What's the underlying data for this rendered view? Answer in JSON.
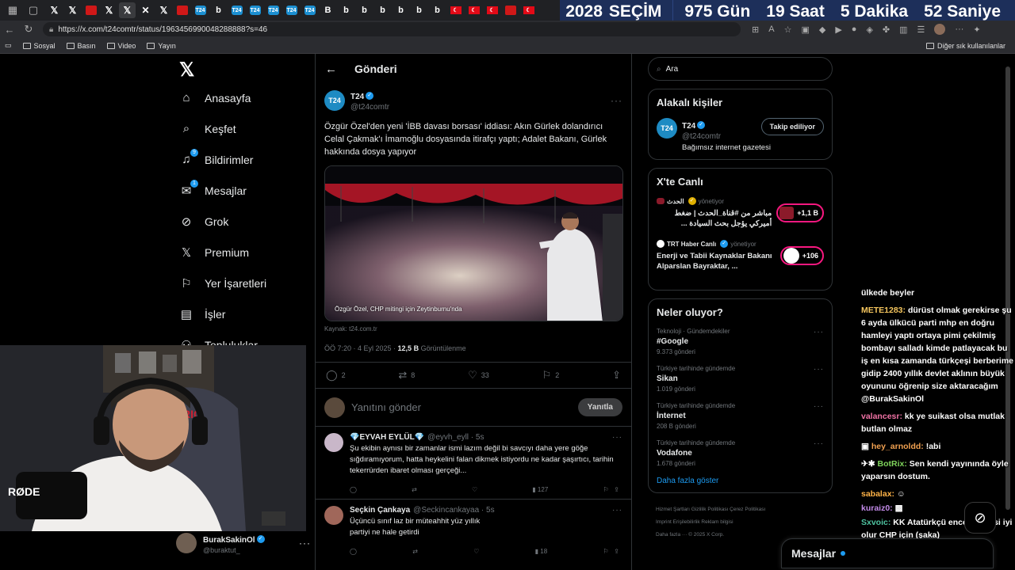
{
  "browser": {
    "url": "https://x.com/t24comtr/status/1963456990048288888?s=46",
    "bookmarks": [
      "Sosyal",
      "Basın",
      "Video",
      "Yayın"
    ],
    "other_bookmarks": "Diğer sık kullanılanlar"
  },
  "countdown": {
    "year": "2028",
    "label": "SEÇİM",
    "days": "975 Gün",
    "hours": "19 Saat",
    "minutes": "5 Dakika",
    "seconds": "52 Saniye"
  },
  "nav": {
    "items": [
      {
        "label": "Anasayfa",
        "icon": "home-icon"
      },
      {
        "label": "Keşfet",
        "icon": "search-icon"
      },
      {
        "label": "Bildirimler",
        "icon": "bell-icon",
        "badge": "9"
      },
      {
        "label": "Mesajlar",
        "icon": "mail-icon",
        "badge": "1"
      },
      {
        "label": "Grok",
        "icon": "grok-icon"
      },
      {
        "label": "Premium",
        "icon": "x-icon"
      },
      {
        "label": "Yer İşaretleri",
        "icon": "bookmark-icon"
      },
      {
        "label": "İşler",
        "icon": "briefcase-icon"
      },
      {
        "label": "Topluluklar",
        "icon": "people-icon"
      }
    ]
  },
  "main": {
    "header": "Gönderi",
    "tweet": {
      "avatar": "T24",
      "name": "T24",
      "handle": "@t24comtr",
      "text": "Özgür Özel'den yeni 'İBB davası borsası' iddiası: Akın Gürlek dolandırıcı Celal Çakmak'ı İmamoğlu dosyasında itirafçı yaptı; Adalet Bakanı, Gürlek hakkında dosya yapıyor",
      "media_caption": "Özgür Özel, CHP mitingi için Zeytinburnu'nda",
      "source": "Kaynak: t24.com.tr",
      "time": "ÖÖ 7:20 · 4 Eyl 2025 · ",
      "views": "12,5 B",
      "views_label": " Görüntülenme",
      "replies": "2",
      "reposts": "8",
      "likes": "33",
      "bookmarks": "2"
    },
    "reply_placeholder": "Yanıtını gönder",
    "reply_button": "Yanıtla",
    "replies": [
      {
        "name": "💎EYVAH EYLÜL💎",
        "handle": "@eyvh_eyll · 5s",
        "text": "Şu ekibin aynısı bir zamanlar ismi lazım değil bi savcıyı daha yere göğe sığdıramıyorum, hatta heykelini falan dikmek istiyordu ne kadar şaşırtıcı, tarihin tekerrürden ibaret olması gerçeği...",
        "views": "127",
        "avatar_color": "#c9b7c9"
      },
      {
        "name": "Seçkin Çankaya",
        "handle": "@Seckincankayaa · 5s",
        "text": "Üçüncü sınıf laz bir müteahhit yüz yıllık partiyi ne hale getirdi",
        "views": "18",
        "avatar_color": "#a0675a"
      }
    ]
  },
  "right": {
    "search_placeholder": "Ara",
    "related": {
      "title": "Alakalı kişiler",
      "name": "T24",
      "handle": "@t24comtr",
      "bio": "Bağımsız internet gazetesi",
      "follow": "Takip ediliyor"
    },
    "live": {
      "title": "X'te Canlı",
      "items": [
        {
          "source": "الحدث",
          "role": "yönetiyor",
          "text": "مباشر من #قناة_الحدث | ضغط أميركي يؤجل بحث السيادة ...",
          "count": "+1,1 B"
        },
        {
          "source": "TRT Haber Canlı",
          "role": "yönetiyor",
          "text": "Enerji ve Tabii Kaynaklar Bakanı Alparslan Bayraktar, ...",
          "count": "+106"
        }
      ]
    },
    "trends": {
      "title": "Neler oluyor?",
      "items": [
        {
          "cat": "Teknoloji · Gündemdekiler",
          "name": "#Google",
          "count": "9.373 gönderi"
        },
        {
          "cat": "Türkiye tarihinde gündemde",
          "name": "Sikan",
          "count": "1.019 gönderi"
        },
        {
          "cat": "Türkiye tarihinde gündemde",
          "name": "İnternet",
          "count": "208 B gönderi"
        },
        {
          "cat": "Türkiye tarihinde gündemde",
          "name": "Vodafone",
          "count": "1.678 gönderi"
        }
      ],
      "show_more": "Daha fazla göster"
    },
    "footer": {
      "line1": "Hizmet Şartları   Gizlilik Politikası   Çerez Politikası",
      "line2": "Imprint   Erişilebilirlik   Reklam bilgisi",
      "line3": "Daha fazla ···   © 2025 X Corp."
    }
  },
  "account": {
    "name": "BurakSakinOl",
    "handle": "@buraktut_"
  },
  "chat": [
    {
      "user": "",
      "text": "ülkede beyler",
      "cls": ""
    },
    {
      "user": "METE1283:",
      "text": "dürüst olmak gerekirse şu 6 ayda ülkücü parti mhp en doğru hamleyi yaptı ortaya pimi çekilmiş bombayı salladı kimde patlayacak bu iş en kısa zamanda türkçeşi berberime gidip 2400 yıllık devlet aklının büyük oyununu öğrenip size aktaracağım @BurakSakinOl",
      "cls": "cu2"
    },
    {
      "user": "valancesr:",
      "text": "kk ye suikast olsa mutlak butlan olmaz",
      "cls": "cu8"
    },
    {
      "user": "hey_arnoldd:",
      "text": "!abi",
      "cls": "cu4"
    },
    {
      "user": "BotRix:",
      "text": "Sen kendi yayınında öyle yaparsın dostum.",
      "cls": "cu6"
    },
    {
      "user": "sabalax:",
      "text": "",
      "cls": "cu7"
    },
    {
      "user": "kuraiz0:",
      "text": "",
      "cls": "cu3"
    },
    {
      "user": "Sxvoic:",
      "text": "KK Atatürkçü ence gelmesi iyi olur CHP için (şaka)",
      "cls": "cu5"
    }
  ],
  "messages_bar": "Mesajlar"
}
